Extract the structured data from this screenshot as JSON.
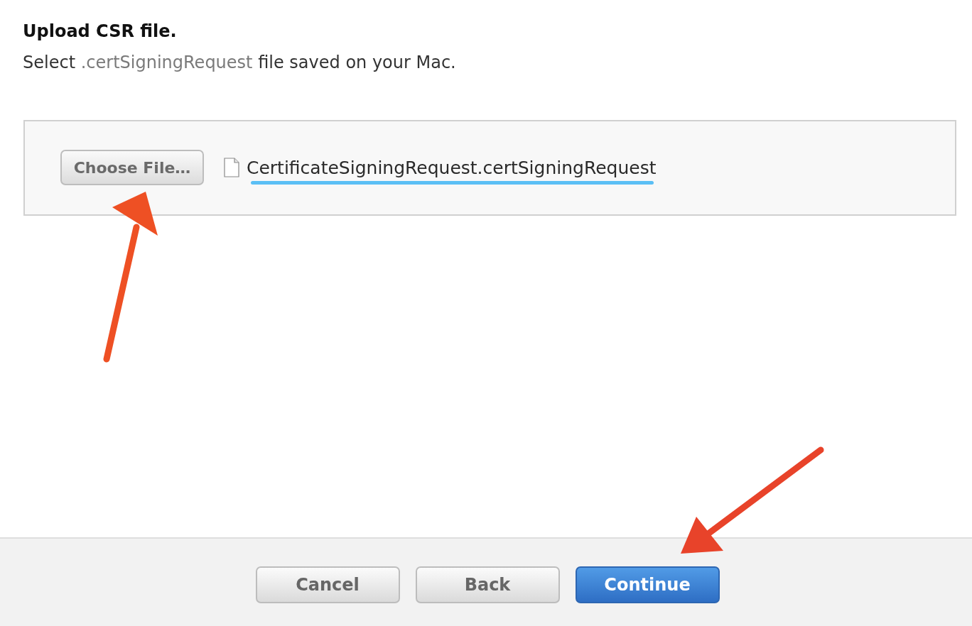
{
  "heading": {
    "title": "Upload CSR file.",
    "subtitle": {
      "lead": "Select",
      "extension": ".certSigningRequest",
      "tail": "file saved on your Mac."
    }
  },
  "file_picker": {
    "button": "Choose File…",
    "file_name": "CertificateSigningRequest.certSigningRequest"
  },
  "footer": {
    "buttons": [
      {
        "label": "Cancel",
        "kind": "secondary"
      },
      {
        "label": "Back",
        "kind": "secondary"
      },
      {
        "label": "Continue",
        "kind": "primary"
      }
    ]
  }
}
